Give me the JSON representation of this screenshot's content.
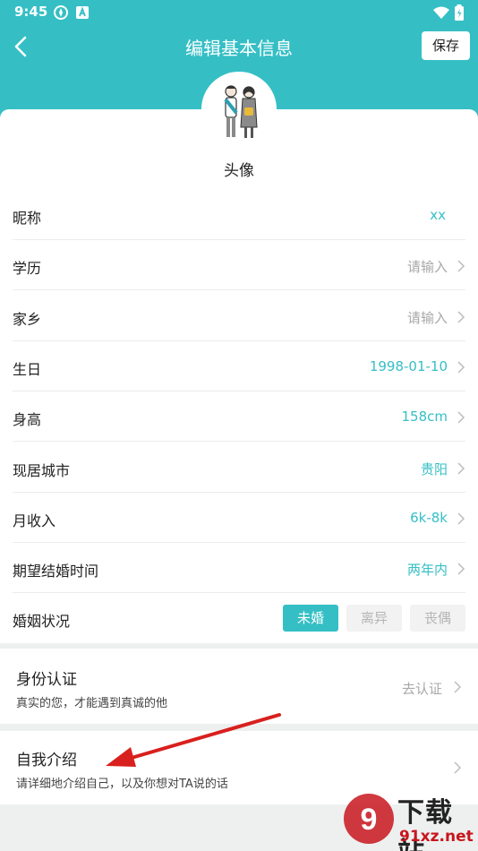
{
  "status_bar": {
    "time": "9:45"
  },
  "header": {
    "title": "编辑基本信息",
    "save_label": "保存"
  },
  "avatar": {
    "label": "头像"
  },
  "fields": [
    {
      "label": "昵称",
      "value": "xx"
    },
    {
      "label": "学历",
      "value": "请输入"
    },
    {
      "label": "家乡",
      "value": "请输入"
    },
    {
      "label": "生日",
      "value": "1998-01-10"
    },
    {
      "label": "身高",
      "value": "158cm"
    },
    {
      "label": "现居城市",
      "value": "贵阳"
    },
    {
      "label": "月收入",
      "value": "6k-8k"
    },
    {
      "label": "期望结婚时间",
      "value": "两年内"
    }
  ],
  "marital": {
    "label": "婚姻状况",
    "options": [
      "未婚",
      "离异",
      "丧偶"
    ],
    "selected": "未婚"
  },
  "identity": {
    "title": "身份认证",
    "subtitle": "真实的您，才能遇到真诚的他",
    "action": "去认证"
  },
  "intro": {
    "title": "自我介绍",
    "subtitle": "请详细地介绍自己，以及你想对TA说的话"
  },
  "watermark": {
    "brand": "下载站",
    "site": "91xz.net",
    "logo_text": "9"
  },
  "colors": {
    "accent": "#35bfc5",
    "annotation": "#d8201e",
    "watermark_red": "#c8161d"
  }
}
